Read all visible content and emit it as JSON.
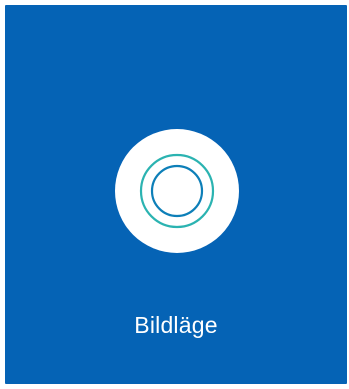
{
  "tile": {
    "label": "Bildläge",
    "background_color": "#0563b5",
    "icon": "picture-mode-icon",
    "icon_colors": {
      "circle": "#ffffff",
      "outer_ring": "#2bb3b1",
      "inner_ring": "#0d7fb8"
    }
  }
}
